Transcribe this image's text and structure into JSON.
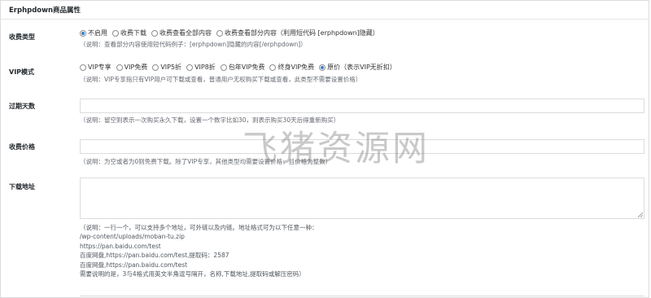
{
  "metabox": {
    "title": "Erphpdown商品属性"
  },
  "fields": {
    "charge_type": {
      "label": "收费类型",
      "options": [
        {
          "label": "不启用",
          "checked": true
        },
        {
          "label": "收费下载",
          "checked": false
        },
        {
          "label": "收费查看全部内容",
          "checked": false
        },
        {
          "label": "收费查看部分内容（利用短代码 [erphpdown]隐藏）",
          "checked": false
        }
      ],
      "description": "（说明：查看部分内容使用短代码例子：[erphpdown]隐藏的内容[/erphpdown]）"
    },
    "vip_mode": {
      "label": "VIP模式",
      "options": [
        {
          "label": "VIP专享",
          "checked": false
        },
        {
          "label": "VIP免费",
          "checked": false
        },
        {
          "label": "VIP5折",
          "checked": false
        },
        {
          "label": "VIP8折",
          "checked": false
        },
        {
          "label": "包年VIP免费",
          "checked": false
        },
        {
          "label": "终身VIP免费",
          "checked": false
        },
        {
          "label": "原价（表示VIP无折扣）",
          "checked": true
        }
      ],
      "description": "（说明：VIP专享指只有VIP用户可下载或查看，普通用户无权购买下载或查看，此类型不需要设置价格）"
    },
    "expire_days": {
      "label": "过期天数",
      "value": "",
      "description": "（说明：留空则表示一次购买永久下载，设置一个数字比如30，则表示购买30天后得重新购买）"
    },
    "price": {
      "label": "收费价格",
      "value": "",
      "description": "（说明：为空或者为0则免费下载。除了VIP专享，其他类型均需要设置价格，且价格为整数）"
    },
    "download_url": {
      "label": "下载地址",
      "value": "",
      "description_lines": [
        "（说明：一行一个，可以支持多个地址，可外链以及内链。地址格式可为以下任意一种：",
        "/wp-content/uploads/moban-tu.zip",
        "https://pan.baidu.com/test",
        "百度网盘,https://pan.baidu.com/test,提取码：2587",
        "百度网盘,https://pan.baidu.com/test",
        "需要说明的是，3与4格式用英文半角逗号隔开，名称,下载地址,提取码或解压密码）"
      ]
    }
  },
  "watermark": {
    "text": "飞猪资源网"
  }
}
